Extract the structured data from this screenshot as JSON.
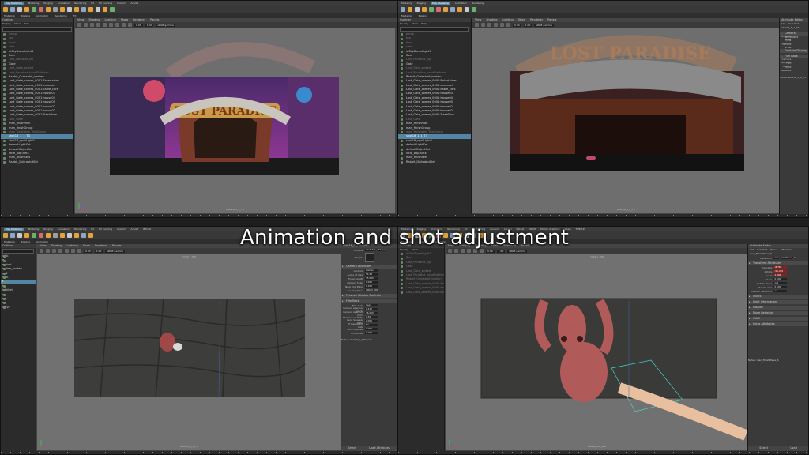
{
  "overlay": {
    "title": "Animation and shot adjustment"
  },
  "menubar": {
    "workspace": "Poly Modeling",
    "items": [
      "Modeling",
      "Rigging",
      "Animation",
      "Rendering",
      "FX",
      "FX Caching",
      "Custom",
      "Arnold",
      "Bifrost",
      "MASH",
      "Motion Graphics",
      "XGen",
      "TURTLE"
    ],
    "window_title": "Poly Modeling"
  },
  "panel_tabs": {
    "outliner": "Outliner",
    "attribute_editor": "Attribute Editor",
    "viewport_menu": [
      "View",
      "Shading",
      "Lighting",
      "Show",
      "Renderer",
      "Panels"
    ],
    "outliner_menu": [
      "Display",
      "Show",
      "Help"
    ],
    "attr_menu": [
      "List",
      "Selected",
      "Focus",
      "Attributes",
      "Show",
      "Help"
    ]
  },
  "viewport": {
    "exposure": "0.00",
    "gamma": "1.00",
    "color_space": "sRGB gamma",
    "resolution_a": "1920 x 768",
    "resolution_b": "1792 x 768",
    "camera_top_left": "shot16_1_1_73",
    "camera_top_right": "shot16_1_1_73",
    "camera_bottom_left": "shot16_1_1_73",
    "camera_bottom_right": "shot16_43_124"
  },
  "outliner_items": [
    {
      "label": "persp",
      "dim": true
    },
    {
      "label": "top",
      "dim": true
    },
    {
      "label": "front",
      "dim": true
    },
    {
      "label": "side",
      "dim": true
    },
    {
      "label": "aiSkyDomeLight1",
      "dim": false
    },
    {
      "label": "floor",
      "dim": false
    },
    {
      "label": "Lost_Paradise_bg",
      "dim": true
    },
    {
      "label": "Gate",
      "dim": false
    },
    {
      "label": "Lost_Gate_sorted",
      "dim": true
    },
    {
      "label": "Lost_Paradise_bandPlatform",
      "dim": true
    },
    {
      "label": "Rabbit_Outrabbit_broken",
      "dim": false
    },
    {
      "label": "Lost_Gate_comes_0001:Entertainer",
      "dim": false
    },
    {
      "label": "Lost_Gate_comes_0001:carousel",
      "dim": false
    },
    {
      "label": "Lost_Gate_comes_0001:cable_cars",
      "dim": false
    },
    {
      "label": "Lost_Gate_comes_0001:house03",
      "dim": false
    },
    {
      "label": "Lost_Gate_comes_0001:house04",
      "dim": false
    },
    {
      "label": "Lost_Gate_comes_0001:house05",
      "dim": false
    },
    {
      "label": "Lost_Gate_comes_0001:house02",
      "dim": false
    },
    {
      "label": "Lost_Gate_comes_0001:house02",
      "dim": false
    },
    {
      "label": "Lost_Gate_comes_0001:TrashSma",
      "dim": false
    },
    {
      "label": "Lost_Gate",
      "dim": true
    },
    {
      "label": "man_finishman",
      "dim": false
    },
    {
      "label": "man_finishGroup",
      "dim": false
    },
    {
      "label": "man_finishsets_TextGroup",
      "dim": true
    },
    {
      "label": "shot16_1_1_73",
      "dim": false,
      "selected": true
    },
    {
      "label": "shot16_spotLight1",
      "dim": false
    },
    {
      "label": "defaultLightSet",
      "dim": false
    },
    {
      "label": "defaultObjectSet",
      "dim": false
    },
    {
      "label": "little_bop:Sets",
      "dim": false
    },
    {
      "label": "man_finishSets",
      "dim": false
    },
    {
      "label": "Rabbit_DollrabbitSet",
      "dim": false
    }
  ],
  "outliner_items_short": [
    "ight1",
    "e",
    "sorted",
    "radise_broken",
    "ge1",
    "ight1",
    "t",
    "t",
    "ightSet",
    "n",
    "set",
    "es",
    "istive"
  ],
  "attr_top_right": {
    "node": "shot16_1_1_73",
    "notes_label": "Notes: shot16_1_1_73",
    "section_camera": "Camera Attributes",
    "section_frustum": "Frustum Display Controls",
    "section_film": "Film Back",
    "rows": [
      {
        "label": "Angle of View",
        "value": "54.43"
      },
      {
        "label": "Focal Length",
        "value": "35.000"
      },
      {
        "label": "Camera Scale",
        "value": "1.000"
      },
      {
        "label": "Near Clip Plane",
        "value": "0.100"
      },
      {
        "label": "Far Clip Plane",
        "value": "10000.000"
      },
      {
        "label": "Camera Aperture",
        "value": "1.417"
      },
      {
        "label": "Film Aspect Ratio",
        "value": "1.500"
      },
      {
        "label": "Lens Squeeze",
        "value": "1.000"
      },
      {
        "label": "Fit Resolution Gate",
        "value": "Fill"
      }
    ]
  },
  "attr_bottom_left": {
    "node_label": "camera:",
    "node": "shot16_1_1Shape1",
    "sample_label": "Sample",
    "notes_label": "Notes: shot16_1_1Shape1",
    "section_camera": "Camera Attributes",
    "section_frustum": "Frustum Display Controls",
    "section_film": "Film Back",
    "controls_label": "Controls",
    "controls_value": "Camera",
    "rows": [
      {
        "label": "Angle of View",
        "value": "54.43"
      },
      {
        "label": "Focal Length",
        "value": "35.000"
      },
      {
        "label": "Camera Scale",
        "value": "1.000"
      },
      {
        "label": "Near Clip Plane",
        "value": "0.100"
      },
      {
        "label": "Far Clip Plane",
        "value": "10000.000"
      },
      {
        "label": "Film Gate",
        "value": "User"
      },
      {
        "label": "Camera Aperture (inch)",
        "value": "1.417"
      },
      {
        "label": "Camera Aperture (mm)",
        "value": "36.000"
      },
      {
        "label": "Film Aspect Ratio",
        "value": "1.50"
      },
      {
        "label": "Lens Squeeze Ratio",
        "value": "1.000"
      },
      {
        "label": "Fit Resolution Gate",
        "value": "Fill"
      },
      {
        "label": "Film Fit Offset",
        "value": "0.000"
      },
      {
        "label": "Film Offset",
        "value": "0.000"
      }
    ],
    "select_button": "Select",
    "load_button": "Load Attributes",
    "side_list": [
      "aiSkyDomeLight1",
      "floor",
      "Lost_Paradise_bg",
      "Lost_Gate_sorted",
      "Rabbit_Outrabbit_broken",
      "man_finishman",
      "man_finishGroup",
      "shot16_1_1_73",
      "shot16_spotLight1",
      "defaultLightSet",
      "defaultObjectSet",
      "little_bop:Sets",
      "man_finishSets",
      "Rabbit_DollrabbitSet"
    ]
  },
  "attr_bottom_right": {
    "node_tab": "man_finishWave_6",
    "transform_label": "Transform:",
    "transform_value": "man_finishWave_6",
    "section_transform": "Transform Attributes",
    "rows": [
      {
        "label": "Translate",
        "value": "-8.787",
        "red": true
      },
      {
        "label": "Rotate",
        "value": "-55.435",
        "red": true
      },
      {
        "label": "Scale",
        "value": "1.000",
        "red": true
      },
      {
        "label": "Shear",
        "value": "0.000",
        "red": false
      },
      {
        "label": "Rotate Order",
        "value": "xyz",
        "red": false
      },
      {
        "label": "Rotate Axis",
        "value": "0.000",
        "red": false
      },
      {
        "label": "Inherits Transform",
        "value": "on",
        "red": false
      }
    ],
    "sections": [
      "Pivots",
      "Limit Information",
      "Display",
      "Node Behavior",
      "UUID",
      "Extra Attributes"
    ],
    "notes_label": "Notes: man_finishWave_6",
    "select_button": "Select",
    "load_button": "Load"
  },
  "attr_top_right_side": {
    "title": "Attribute Editor",
    "node": "shot16_1_1_73",
    "section_camera": "Camera Attributes",
    "section_frustum": "Frustum Display",
    "section_film": "Film Back",
    "rows": [
      "Angle of View",
      "Focal Length",
      "Camera Scale",
      "Near Clip Plane",
      "Far Clip Plane",
      "Camera Aperture",
      "Film Aspect",
      "Lens Squeeze",
      "Fit Resolution"
    ],
    "notes_label": "Notes: shot16_1_1_73"
  },
  "scene": {
    "sign_text": "LOST PARADISE"
  },
  "colors": {
    "selection": "#5285a6",
    "background": "#444444",
    "viewport": "#6b6b6b",
    "outliner": "#2b2b2b"
  }
}
